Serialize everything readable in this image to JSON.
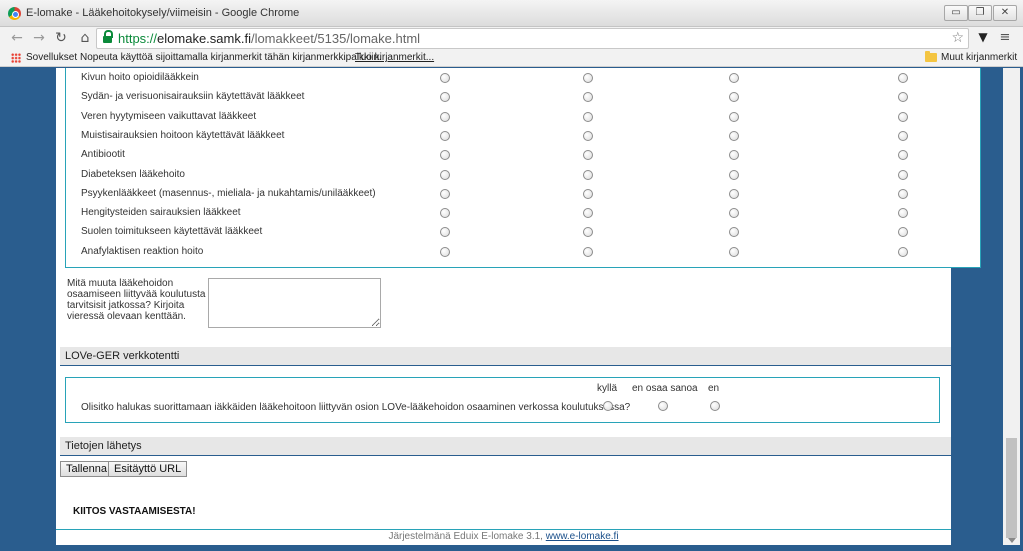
{
  "window": {
    "title": "E-lomake - Lääkehoitokysely/viimeisin - Google Chrome",
    "min_glyph": "▭",
    "max_glyph": "❐",
    "close_glyph": "✕"
  },
  "toolbar": {
    "back_glyph": "←",
    "forward_glyph": "→",
    "reload_glyph": "↻",
    "home_glyph": "⌂",
    "url_scheme": "https://",
    "url_host": "elomake.samk.fi",
    "url_path": "/lomakkeet/5135/lomake.html",
    "star_glyph": "☆",
    "menu_glyph": "≡",
    "ext_glyph": "▼",
    "icons": [
      "back-icon",
      "forward-icon",
      "reload-icon",
      "home-icon",
      "lock-icon",
      "star-icon",
      "extension-icon",
      "menu-icon"
    ]
  },
  "bookmarks": {
    "apps": "Sovellukset",
    "hint": "Nopeuta käyttöä sijoittamalla kirjanmerkit tähän kirjanmerkkipalkkiin.",
    "import": "Tuo kirjanmerkit...",
    "other": "Muut kirjanmerkit"
  },
  "medication_questions": [
    {
      "label": "Kivun hoito opioidilääkkein"
    },
    {
      "label": "Sydän- ja verisuonisairauksiin käytettävät lääkkeet"
    },
    {
      "label": "Veren hyytymiseen vaikuttavat lääkkeet"
    },
    {
      "label": "Muistisairauksien hoitoon käytettävät lääkkeet"
    },
    {
      "label": "Antibiootit"
    },
    {
      "label": "Diabeteksen lääkehoito"
    },
    {
      "label": "Psyykenlääkkeet (masennus-, mieliala- ja nukahtamis/unilääkkeet)"
    },
    {
      "label": "Hengitysteiden sairauksien lääkkeet"
    },
    {
      "label": "Suolen toimitukseen käytettävät lääkkeet"
    },
    {
      "label": "Anafylaktisen reaktion hoito"
    }
  ],
  "training_question": {
    "label": "Mitä muuta lääkehoidon osaamiseen liittyvää koulutusta tarvitsisit jatkossa? Kirjoita vieressä olevaan kenttään.",
    "value": ""
  },
  "section_lovе": "LOVe-GER verkkotentti",
  "online_question": {
    "options": [
      "kyllä",
      "en osaa sanoa",
      "en"
    ],
    "label": "Olisitko halukas suorittamaan iäkkäiden lääkehoitoon liittyvän osion LOVe-lääkehoidon osaaminen verkossa koulutuksessa?"
  },
  "section_submit": "Tietojen lähetys",
  "buttons": {
    "save": "Tallenna",
    "prefill": "Esitäyttö URL"
  },
  "thanks": "KIITOS VASTAAMISESTA!",
  "footer": {
    "text": "Järjestelmänä Eduix E-lomake 3.1,",
    "link": "www.e-lomake.fi"
  }
}
